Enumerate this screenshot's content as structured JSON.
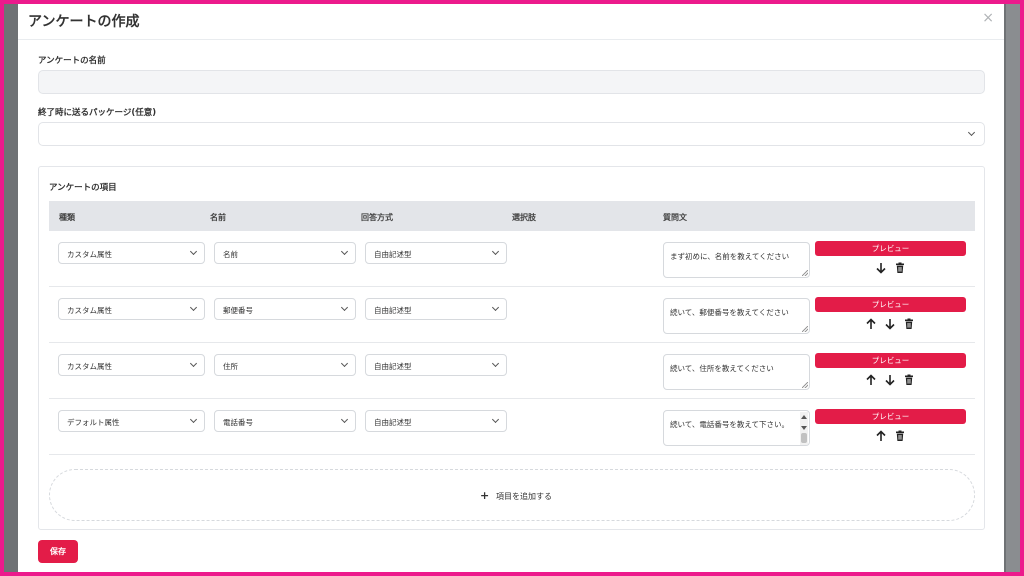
{
  "modal": {
    "title": "アンケートの作成",
    "close_glyph": "×"
  },
  "form": {
    "name_label": "アンケートの名前",
    "name_value": "",
    "package_label": "終了時に送るパッケージ(任意)",
    "package_value": ""
  },
  "items_section": {
    "title": "アンケートの項目",
    "columns": [
      "種類",
      "名前",
      "回答方式",
      "選択肢",
      "質問文"
    ],
    "rows": [
      {
        "type": "カスタム属性",
        "name": "名前",
        "answer": "自由記述型",
        "question": "まず初めに、名前を教えてください",
        "icons": [
          "arrow-down-icon",
          "trash-icon"
        ]
      },
      {
        "type": "カスタム属性",
        "name": "郵便番号",
        "answer": "自由記述型",
        "question": "続いて、郵便番号を教えてください",
        "icons": [
          "arrow-up-icon",
          "arrow-down-icon",
          "trash-icon"
        ]
      },
      {
        "type": "カスタム属性",
        "name": "住所",
        "answer": "自由記述型",
        "question": "続いて、住所を教えてください",
        "icons": [
          "arrow-up-icon",
          "arrow-down-icon",
          "trash-icon"
        ]
      },
      {
        "type": "デフォルト属性",
        "name": "電話番号",
        "answer": "自由記述型",
        "question": "続いて、電話番号を教えて下さい。",
        "icons": [
          "arrow-up-icon",
          "trash-icon"
        ]
      }
    ],
    "preview_label": "プレビュー",
    "add_label": "項目を追加する",
    "add_glyph": "+"
  },
  "footer": {
    "save_label": "保存"
  },
  "colors": {
    "accent": "#e31c48",
    "frame": "#ec1a8c",
    "header_bg": "#e3e5e9"
  }
}
